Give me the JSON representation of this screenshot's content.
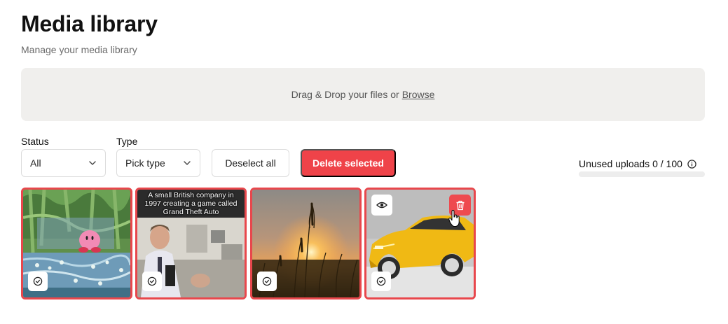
{
  "header": {
    "title": "Media library",
    "subtitle": "Manage your media library"
  },
  "dropzone": {
    "text": "Drag & Drop your files or",
    "browse_label": "Browse"
  },
  "filters": {
    "status_label": "Status",
    "status_value": "All",
    "type_label": "Type",
    "type_value": "Pick type"
  },
  "actions": {
    "deselect_all": "Deselect all",
    "delete_selected": "Delete selected"
  },
  "usage": {
    "label": "Unused uploads 0 / 100",
    "used": 0,
    "limit": 100,
    "info_icon": "info-icon"
  },
  "media": [
    {
      "alt": "Kirby painting",
      "selected": true
    },
    {
      "alt": "Video thumbnail",
      "selected": true,
      "caption": "A small British company in 1997 creating a game called Grand Theft Auto"
    },
    {
      "alt": "Sunset over grass",
      "selected": true
    },
    {
      "alt": "Yellow car",
      "selected": true,
      "hovered": true
    }
  ],
  "colors": {
    "accent": "#ef4349",
    "dropzone_bg": "#f0efed",
    "subtitle": "#6b6b6b"
  }
}
